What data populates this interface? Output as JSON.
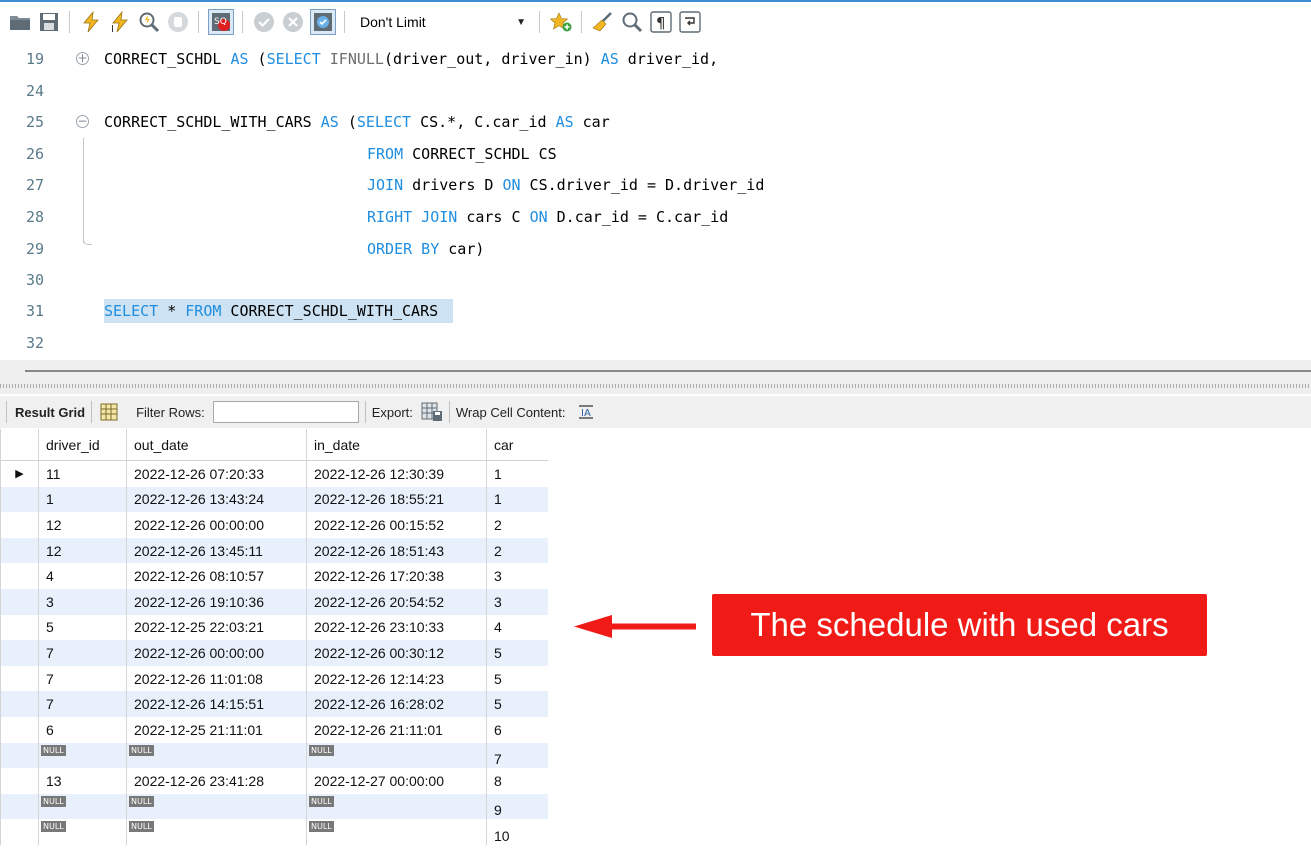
{
  "toolbar": {
    "limit_value": "Don't Limit"
  },
  "editor": {
    "lines": [
      {
        "num": "19"
      },
      {
        "num": "24"
      },
      {
        "num": "25"
      },
      {
        "num": "26"
      },
      {
        "num": "27"
      },
      {
        "num": "28"
      },
      {
        "num": "29"
      },
      {
        "num": "30"
      },
      {
        "num": "31"
      },
      {
        "num": "32"
      }
    ],
    "code": {
      "l19_a": "CORRECT_SCHDL ",
      "l19_kw1": "AS",
      "l19_b": " (",
      "l19_kw2": "SELECT",
      "l19_fn": " IFNULL",
      "l19_c": "(driver_out, driver_in) ",
      "l19_kw3": "AS",
      "l19_d": " driver_id,",
      "l25_a": "CORRECT_SCHDL_WITH_CARS ",
      "l25_kw1": "AS",
      "l25_b": " (",
      "l25_kw2": "SELECT",
      "l25_c": " CS.*, C.car_id ",
      "l25_kw3": "AS",
      "l25_d": " car",
      "l26_kw": "FROM",
      "l26_a": " CORRECT_SCHDL CS",
      "l27_kw1": "JOIN",
      "l27_a": " drivers D ",
      "l27_kw2": "ON",
      "l27_b": " CS.driver_id = D.driver_id",
      "l28_kw1": "RIGHT JOIN",
      "l28_a": " cars C ",
      "l28_kw2": "ON",
      "l28_b": " D.car_id = C.car_id",
      "l29_kw": "ORDER BY",
      "l29_a": " car)",
      "l31_kw1": "SELECT",
      "l31_a": " * ",
      "l31_kw2": "FROM",
      "l31_b": " CORRECT_SCHDL_WITH_CARS"
    }
  },
  "result_toolbar": {
    "result_grid": "Result Grid",
    "filter_rows": "Filter Rows:",
    "export": "Export:",
    "wrap_cell": "Wrap Cell Content:"
  },
  "grid": {
    "columns": [
      "driver_id",
      "out_date",
      "in_date",
      "car"
    ],
    "null_label": "NULL",
    "rows": [
      {
        "driver_id": "11",
        "out_date": "2022-12-26 07:20:33",
        "in_date": "2022-12-26 12:30:39",
        "car": "1"
      },
      {
        "driver_id": "1",
        "out_date": "2022-12-26 13:43:24",
        "in_date": "2022-12-26 18:55:21",
        "car": "1"
      },
      {
        "driver_id": "12",
        "out_date": "2022-12-26 00:00:00",
        "in_date": "2022-12-26 00:15:52",
        "car": "2"
      },
      {
        "driver_id": "12",
        "out_date": "2022-12-26 13:45:11",
        "in_date": "2022-12-26 18:51:43",
        "car": "2"
      },
      {
        "driver_id": "4",
        "out_date": "2022-12-26 08:10:57",
        "in_date": "2022-12-26 17:20:38",
        "car": "3"
      },
      {
        "driver_id": "3",
        "out_date": "2022-12-26 19:10:36",
        "in_date": "2022-12-26 20:54:52",
        "car": "3"
      },
      {
        "driver_id": "5",
        "out_date": "2022-12-25 22:03:21",
        "in_date": "2022-12-26 23:10:33",
        "car": "4"
      },
      {
        "driver_id": "7",
        "out_date": "2022-12-26 00:00:00",
        "in_date": "2022-12-26 00:30:12",
        "car": "5"
      },
      {
        "driver_id": "7",
        "out_date": "2022-12-26 11:01:08",
        "in_date": "2022-12-26 12:14:23",
        "car": "5"
      },
      {
        "driver_id": "7",
        "out_date": "2022-12-26 14:15:51",
        "in_date": "2022-12-26 16:28:02",
        "car": "5"
      },
      {
        "driver_id": "6",
        "out_date": "2022-12-25 21:11:01",
        "in_date": "2022-12-26 21:11:01",
        "car": "6"
      },
      {
        "driver_id": null,
        "out_date": null,
        "in_date": null,
        "car": "7"
      },
      {
        "driver_id": "13",
        "out_date": "2022-12-26 23:41:28",
        "in_date": "2022-12-27 00:00:00",
        "car": "8"
      },
      {
        "driver_id": null,
        "out_date": null,
        "in_date": null,
        "car": "9"
      },
      {
        "driver_id": null,
        "out_date": null,
        "in_date": null,
        "car": "10"
      }
    ]
  },
  "annotation": {
    "text": "The schedule with used cars",
    "color": "#f01b17"
  }
}
